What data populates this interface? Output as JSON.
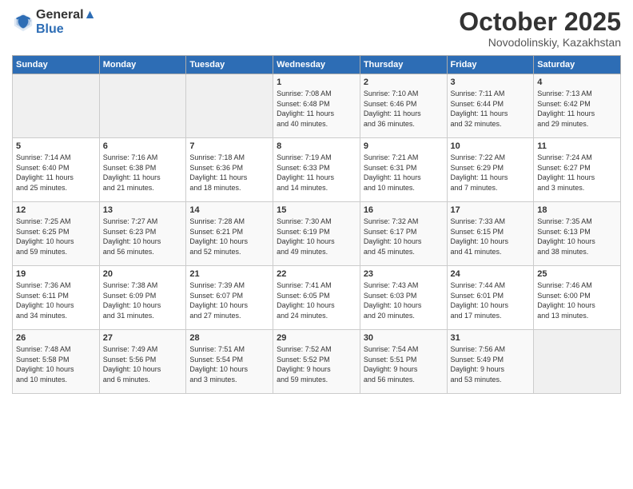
{
  "header": {
    "logo_line1": "General",
    "logo_line2": "Blue",
    "month": "October 2025",
    "location": "Novodolinskiy, Kazakhstan"
  },
  "weekdays": [
    "Sunday",
    "Monday",
    "Tuesday",
    "Wednesday",
    "Thursday",
    "Friday",
    "Saturday"
  ],
  "weeks": [
    [
      {
        "day": "",
        "info": ""
      },
      {
        "day": "",
        "info": ""
      },
      {
        "day": "",
        "info": ""
      },
      {
        "day": "1",
        "info": "Sunrise: 7:08 AM\nSunset: 6:48 PM\nDaylight: 11 hours\nand 40 minutes."
      },
      {
        "day": "2",
        "info": "Sunrise: 7:10 AM\nSunset: 6:46 PM\nDaylight: 11 hours\nand 36 minutes."
      },
      {
        "day": "3",
        "info": "Sunrise: 7:11 AM\nSunset: 6:44 PM\nDaylight: 11 hours\nand 32 minutes."
      },
      {
        "day": "4",
        "info": "Sunrise: 7:13 AM\nSunset: 6:42 PM\nDaylight: 11 hours\nand 29 minutes."
      }
    ],
    [
      {
        "day": "5",
        "info": "Sunrise: 7:14 AM\nSunset: 6:40 PM\nDaylight: 11 hours\nand 25 minutes."
      },
      {
        "day": "6",
        "info": "Sunrise: 7:16 AM\nSunset: 6:38 PM\nDaylight: 11 hours\nand 21 minutes."
      },
      {
        "day": "7",
        "info": "Sunrise: 7:18 AM\nSunset: 6:36 PM\nDaylight: 11 hours\nand 18 minutes."
      },
      {
        "day": "8",
        "info": "Sunrise: 7:19 AM\nSunset: 6:33 PM\nDaylight: 11 hours\nand 14 minutes."
      },
      {
        "day": "9",
        "info": "Sunrise: 7:21 AM\nSunset: 6:31 PM\nDaylight: 11 hours\nand 10 minutes."
      },
      {
        "day": "10",
        "info": "Sunrise: 7:22 AM\nSunset: 6:29 PM\nDaylight: 11 hours\nand 7 minutes."
      },
      {
        "day": "11",
        "info": "Sunrise: 7:24 AM\nSunset: 6:27 PM\nDaylight: 11 hours\nand 3 minutes."
      }
    ],
    [
      {
        "day": "12",
        "info": "Sunrise: 7:25 AM\nSunset: 6:25 PM\nDaylight: 10 hours\nand 59 minutes."
      },
      {
        "day": "13",
        "info": "Sunrise: 7:27 AM\nSunset: 6:23 PM\nDaylight: 10 hours\nand 56 minutes."
      },
      {
        "day": "14",
        "info": "Sunrise: 7:28 AM\nSunset: 6:21 PM\nDaylight: 10 hours\nand 52 minutes."
      },
      {
        "day": "15",
        "info": "Sunrise: 7:30 AM\nSunset: 6:19 PM\nDaylight: 10 hours\nand 49 minutes."
      },
      {
        "day": "16",
        "info": "Sunrise: 7:32 AM\nSunset: 6:17 PM\nDaylight: 10 hours\nand 45 minutes."
      },
      {
        "day": "17",
        "info": "Sunrise: 7:33 AM\nSunset: 6:15 PM\nDaylight: 10 hours\nand 41 minutes."
      },
      {
        "day": "18",
        "info": "Sunrise: 7:35 AM\nSunset: 6:13 PM\nDaylight: 10 hours\nand 38 minutes."
      }
    ],
    [
      {
        "day": "19",
        "info": "Sunrise: 7:36 AM\nSunset: 6:11 PM\nDaylight: 10 hours\nand 34 minutes."
      },
      {
        "day": "20",
        "info": "Sunrise: 7:38 AM\nSunset: 6:09 PM\nDaylight: 10 hours\nand 31 minutes."
      },
      {
        "day": "21",
        "info": "Sunrise: 7:39 AM\nSunset: 6:07 PM\nDaylight: 10 hours\nand 27 minutes."
      },
      {
        "day": "22",
        "info": "Sunrise: 7:41 AM\nSunset: 6:05 PM\nDaylight: 10 hours\nand 24 minutes."
      },
      {
        "day": "23",
        "info": "Sunrise: 7:43 AM\nSunset: 6:03 PM\nDaylight: 10 hours\nand 20 minutes."
      },
      {
        "day": "24",
        "info": "Sunrise: 7:44 AM\nSunset: 6:01 PM\nDaylight: 10 hours\nand 17 minutes."
      },
      {
        "day": "25",
        "info": "Sunrise: 7:46 AM\nSunset: 6:00 PM\nDaylight: 10 hours\nand 13 minutes."
      }
    ],
    [
      {
        "day": "26",
        "info": "Sunrise: 7:48 AM\nSunset: 5:58 PM\nDaylight: 10 hours\nand 10 minutes."
      },
      {
        "day": "27",
        "info": "Sunrise: 7:49 AM\nSunset: 5:56 PM\nDaylight: 10 hours\nand 6 minutes."
      },
      {
        "day": "28",
        "info": "Sunrise: 7:51 AM\nSunset: 5:54 PM\nDaylight: 10 hours\nand 3 minutes."
      },
      {
        "day": "29",
        "info": "Sunrise: 7:52 AM\nSunset: 5:52 PM\nDaylight: 9 hours\nand 59 minutes."
      },
      {
        "day": "30",
        "info": "Sunrise: 7:54 AM\nSunset: 5:51 PM\nDaylight: 9 hours\nand 56 minutes."
      },
      {
        "day": "31",
        "info": "Sunrise: 7:56 AM\nSunset: 5:49 PM\nDaylight: 9 hours\nand 53 minutes."
      },
      {
        "day": "",
        "info": ""
      }
    ]
  ]
}
